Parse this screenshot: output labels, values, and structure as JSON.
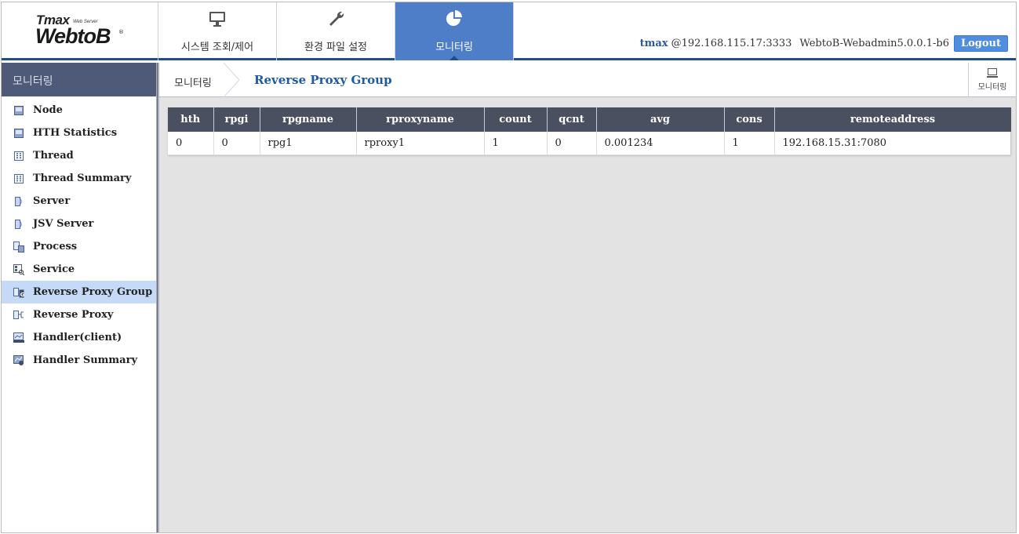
{
  "logo": {
    "brand": "Tmax",
    "tagline": "Web Server",
    "product": "WebtoB",
    "registered": "®"
  },
  "topnav": {
    "tabs": [
      {
        "label": "시스템 조회/제어",
        "icon": "monitor-icon",
        "active": false
      },
      {
        "label": "환경 파일 설정",
        "icon": "wrench-icon",
        "active": false
      },
      {
        "label": "모니터링",
        "icon": "pie-chart-icon",
        "active": true
      }
    ]
  },
  "userinfo": {
    "user": "tmax",
    "host": "@192.168.115.17:3333",
    "version": "WebtoB-Webadmin5.0.0.1-b6",
    "logout_label": "Logout"
  },
  "sidebar": {
    "title": "모니터링",
    "items": [
      {
        "label": "Node",
        "icon": "node-icon"
      },
      {
        "label": "HTH Statistics",
        "icon": "hth-statistics-icon"
      },
      {
        "label": "Thread",
        "icon": "thread-icon"
      },
      {
        "label": "Thread Summary",
        "icon": "thread-summary-icon"
      },
      {
        "label": "Server",
        "icon": "server-icon"
      },
      {
        "label": "JSV Server",
        "icon": "jsv-server-icon"
      },
      {
        "label": "Process",
        "icon": "process-icon"
      },
      {
        "label": "Service",
        "icon": "service-icon"
      },
      {
        "label": "Reverse Proxy Group",
        "icon": "reverse-proxy-group-icon",
        "active": true
      },
      {
        "label": "Reverse Proxy",
        "icon": "reverse-proxy-icon"
      },
      {
        "label": "Handler(client)",
        "icon": "handler-client-icon"
      },
      {
        "label": "Handler Summary",
        "icon": "handler-summary-icon"
      }
    ]
  },
  "breadcrumb": {
    "root": "모니터링",
    "current": "Reverse Proxy Group"
  },
  "monitor_button": {
    "label": "모니터링",
    "icon": "monitor-icon"
  },
  "table": {
    "columns": [
      "hth",
      "rpgi",
      "rpgname",
      "rproxyname",
      "count",
      "qcnt",
      "avg",
      "cons",
      "remoteaddress"
    ],
    "rows": [
      [
        "0",
        "0",
        "rpg1",
        "rproxy1",
        "1",
        "0",
        "0.001234",
        "1",
        "192.168.15.31:7080"
      ]
    ]
  },
  "colors": {
    "accent": "#4f7ec8",
    "header_line": "#1f4e8c",
    "sidebar_head": "#4e5a78",
    "table_head": "#4a5060",
    "active_item": "#c4daf6",
    "logout": "#4f8de0"
  }
}
